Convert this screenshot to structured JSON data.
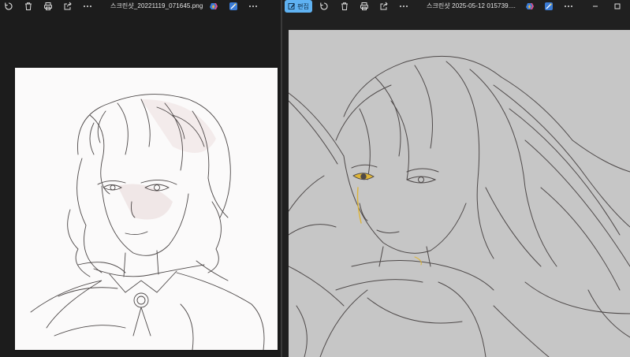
{
  "left_viewer": {
    "file_name": "스크린샷_20221119_071645.png",
    "toolbar_icons": [
      "rotate-icon",
      "delete-icon",
      "print-icon",
      "share-icon",
      "more-icon",
      "copilot-icon",
      "designer-icon",
      "more-icon"
    ]
  },
  "right_viewer": {
    "edit_label": "편집",
    "file_name": "스크린샷 2025-05-12 015739....",
    "toolbar_icons": [
      "rotate-icon",
      "delete-icon",
      "print-icon",
      "share-icon",
      "more-icon",
      "copilot-icon",
      "designer-icon",
      "more-icon"
    ],
    "window_controls": [
      "minimize-icon",
      "maximize-icon"
    ]
  },
  "colors": {
    "app_background": "#1c1c1c",
    "edit_accent": "#5fb2f2",
    "canvas_left": "#fbfafa",
    "canvas_right": "#c6c6c6",
    "sketch_line": "#3a3434",
    "eye_highlight": "#e3b320"
  }
}
